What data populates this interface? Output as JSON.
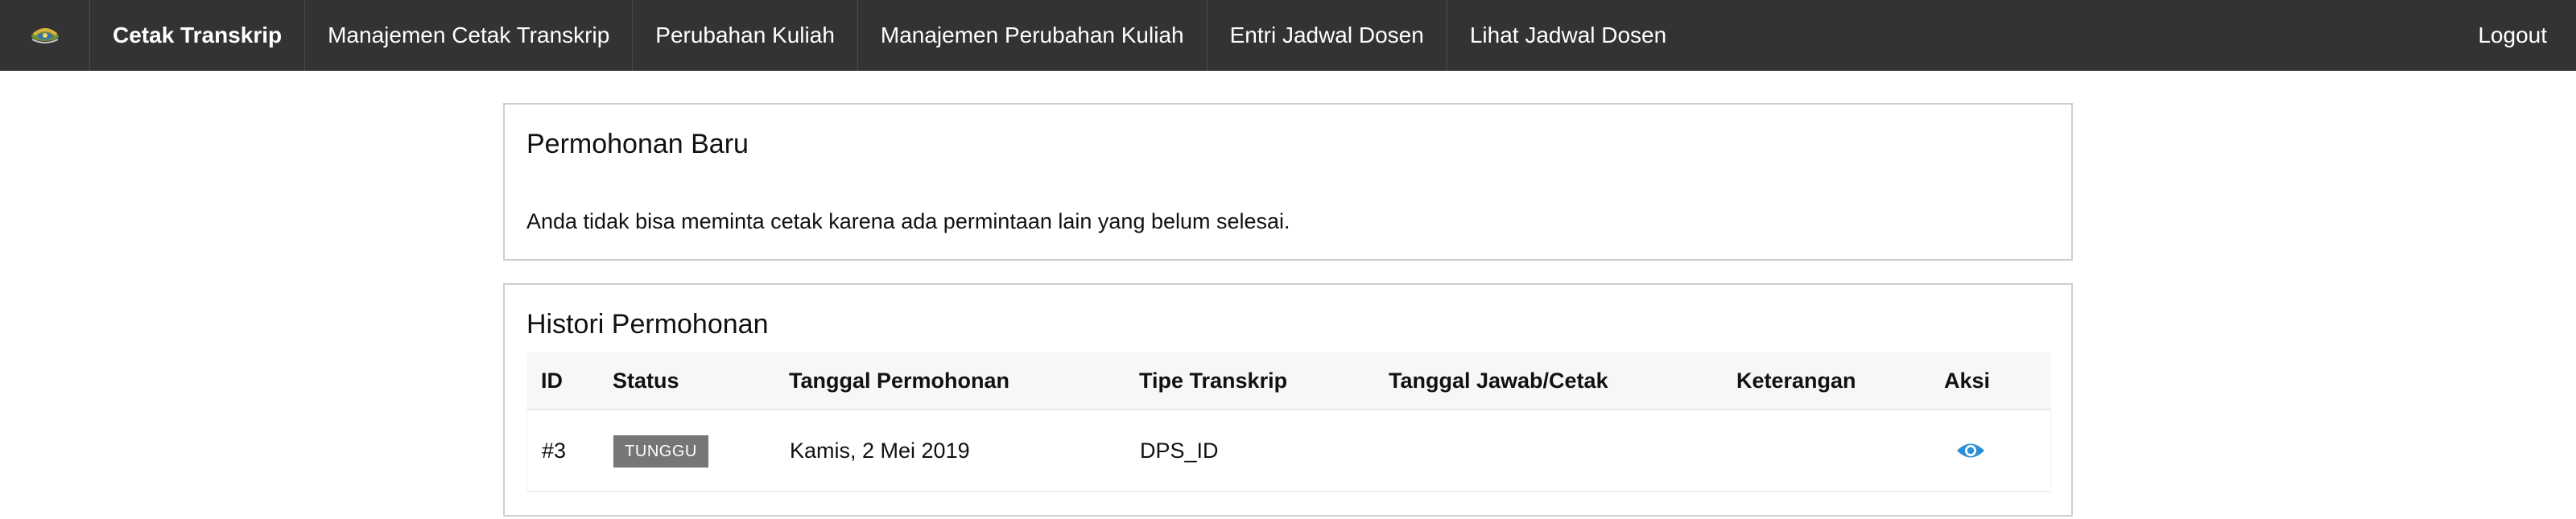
{
  "nav": {
    "logo_icon": "university-logo-icon",
    "items": [
      {
        "label": "Cetak Transkrip",
        "active": true
      },
      {
        "label": "Manajemen Cetak Transkrip"
      },
      {
        "label": "Perubahan Kuliah"
      },
      {
        "label": "Manajemen Perubahan Kuliah"
      },
      {
        "label": "Entri Jadwal Dosen"
      },
      {
        "label": "Lihat Jadwal Dosen"
      }
    ],
    "logout_label": "Logout"
  },
  "new_request": {
    "title": "Permohonan Baru",
    "message": "Anda tidak bisa meminta cetak karena ada permintaan lain yang belum selesai."
  },
  "history": {
    "title": "Histori Permohonan",
    "columns": [
      "ID",
      "Status",
      "Tanggal Permohonan",
      "Tipe Transkrip",
      "Tanggal Jawab/Cetak",
      "Keterangan",
      "Aksi"
    ],
    "rows": [
      {
        "id": "#3",
        "status": "TUNGGU",
        "request_date": "Kamis, 2 Mei 2019",
        "transcript_type": "DPS_ID",
        "response_date": "",
        "note": "",
        "action_icon": "eye-icon"
      }
    ]
  },
  "colors": {
    "navbar": "#333333",
    "badge": "#767676",
    "action_icon": "#2a8fd8"
  }
}
